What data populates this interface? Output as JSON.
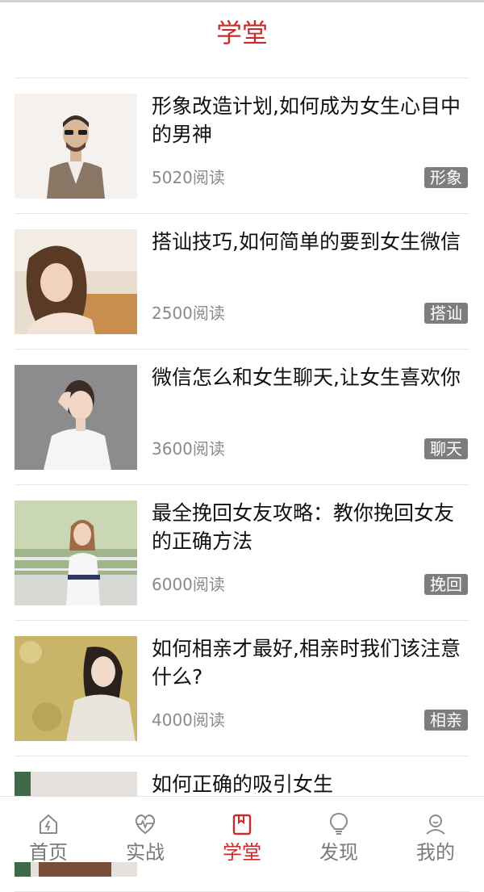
{
  "header": {
    "title": "学堂"
  },
  "articles": [
    {
      "title": "形象改造计划,如何成为女生心目中的男神",
      "reads": "5020阅读",
      "tag": "形象"
    },
    {
      "title": "搭讪技巧,如何简单的要到女生微信",
      "reads": "2500阅读",
      "tag": "搭讪"
    },
    {
      "title": "微信怎么和女生聊天,让女生喜欢你",
      "reads": "3600阅读",
      "tag": "聊天"
    },
    {
      "title": "最全挽回女友攻略：教你挽回女友的正确方法",
      "reads": "6000阅读",
      "tag": "挽回"
    },
    {
      "title": "如何相亲才最好,相亲时我们该注意什么?",
      "reads": "4000阅读",
      "tag": "相亲"
    },
    {
      "title": "如何正确的吸引女生",
      "reads": "",
      "tag": ""
    }
  ],
  "tabs": [
    {
      "label": "首页",
      "icon": "home-icon"
    },
    {
      "label": "实战",
      "icon": "heartbeat-icon"
    },
    {
      "label": "学堂",
      "icon": "book-icon"
    },
    {
      "label": "发现",
      "icon": "lightbulb-icon"
    },
    {
      "label": "我的",
      "icon": "profile-icon"
    }
  ],
  "colors": {
    "accent": "#cc2b2b",
    "tag_bg": "#7d7d7d",
    "text": "#111111",
    "muted": "#8a8a8a"
  }
}
